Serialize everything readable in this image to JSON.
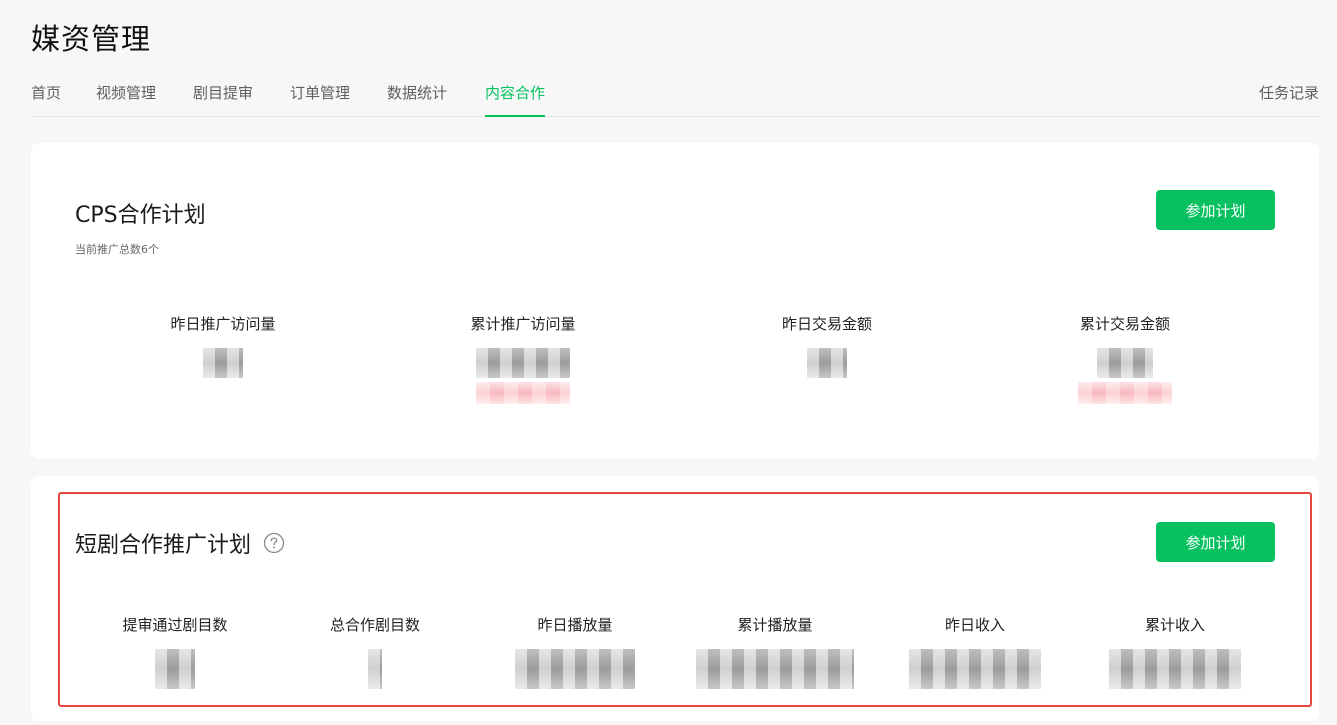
{
  "page": {
    "title": "媒资管理"
  },
  "nav": {
    "tabs": [
      {
        "label": "首页",
        "active": false
      },
      {
        "label": "视频管理",
        "active": false
      },
      {
        "label": "剧目提审",
        "active": false
      },
      {
        "label": "订单管理",
        "active": false
      },
      {
        "label": "数据统计",
        "active": false
      },
      {
        "label": "内容合作",
        "active": true
      }
    ],
    "task_record": "任务记录"
  },
  "cps_plan": {
    "title": "CPS合作计划",
    "subtitle": "当前推广总数6个",
    "join_label": "参加计划",
    "metrics": [
      {
        "label": "昨日推广访问量"
      },
      {
        "label": "累计推广访问量"
      },
      {
        "label": "昨日交易金额"
      },
      {
        "label": "累计交易金额"
      }
    ]
  },
  "short_drama_plan": {
    "title": "短剧合作推广计划",
    "join_label": "参加计划",
    "metrics": [
      {
        "label": "提审通过剧目数"
      },
      {
        "label": "总合作剧目数"
      },
      {
        "label": "昨日播放量"
      },
      {
        "label": "累计播放量"
      },
      {
        "label": "昨日收入"
      },
      {
        "label": "累计收入"
      }
    ]
  },
  "colors": {
    "accent": "#07c160",
    "highlight_border": "#e8473f",
    "page_bg": "#f7f7f7"
  },
  "icons": {
    "help": "question-circle-icon"
  }
}
